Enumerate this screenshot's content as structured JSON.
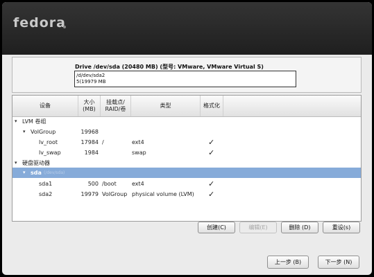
{
  "banner": {
    "logo_text": "fedora"
  },
  "drive": {
    "title": "Drive /dev/sda (20480 MB) (型号: VMware, VMware Virtual S)",
    "bar_line1": "/d/dev/sda2",
    "bar_line2": "5(19979 MB"
  },
  "table": {
    "headers": {
      "device": "设备",
      "size": "大小\n(MB)",
      "mount": "挂载点/\nRAID/卷",
      "type": "类型",
      "format": "格式化"
    },
    "rows": [
      {
        "name": "LVM 卷组",
        "size": "",
        "mount": "",
        "type": "",
        "format": false,
        "expanded": true
      },
      {
        "name": "VolGroup",
        "size": "19968",
        "mount": "",
        "type": "",
        "format": false,
        "expanded": true
      },
      {
        "name": "lv_root",
        "size": "17984",
        "mount": "/",
        "type": "ext4",
        "format": true
      },
      {
        "name": "lv_swap",
        "size": "1984",
        "mount": "",
        "type": "swap",
        "format": true
      },
      {
        "name": "硬盘驱动器",
        "size": "",
        "mount": "",
        "type": "",
        "format": false,
        "expanded": true
      },
      {
        "name": "sda",
        "sub": "(/dev/sda)",
        "size": "",
        "mount": "",
        "type": "",
        "format": false,
        "expanded": true,
        "selected": true
      },
      {
        "name": "sda1",
        "size": "500",
        "mount": "/boot",
        "type": "ext4",
        "format": true
      },
      {
        "name": "sda2",
        "size": "19979",
        "mount": "VolGroup",
        "type": "physical volume (LVM)",
        "format": true
      }
    ],
    "check_glyph": "✓"
  },
  "actions": {
    "create": "创建(C)",
    "edit": "编辑(E)",
    "delete": "删除 (D)",
    "reset": "重设(s)"
  },
  "nav": {
    "back": "上一步 (B)",
    "next": "下一步 (N)"
  }
}
